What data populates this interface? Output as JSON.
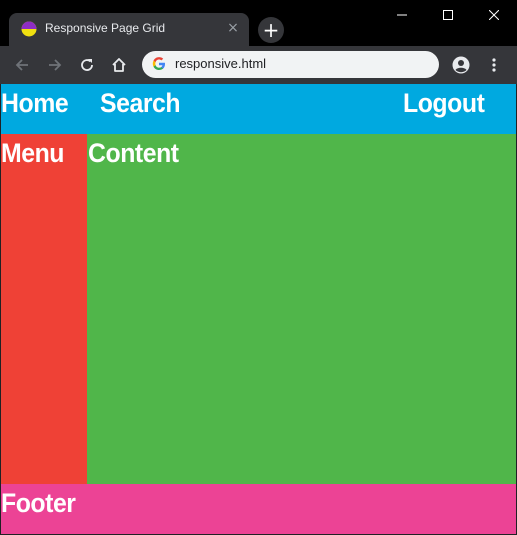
{
  "browser": {
    "tab": {
      "title": "Responsive Page Grid",
      "close": "×",
      "favicon": "pie-favicon-icon"
    },
    "new_tab": "+",
    "window_controls": [
      "minimize-icon",
      "maximize-icon",
      "close-icon"
    ],
    "toolbar": {
      "back": "back-arrow-icon",
      "forward": "forward-arrow-icon",
      "reload": "reload-icon",
      "home": "home-icon",
      "url": "responsive.html",
      "profile": "profile-icon",
      "menu": "kebab-menu-icon"
    }
  },
  "page": {
    "header": {
      "home": "Home",
      "search": "Search",
      "logout": "Logout"
    },
    "menu_label": "Menu",
    "content_label": "Content",
    "footer_label": "Footer"
  },
  "colors": {
    "header": "#00a9e0",
    "menu": "#ef4136",
    "content": "#50b64a",
    "footer": "#ec4395"
  }
}
